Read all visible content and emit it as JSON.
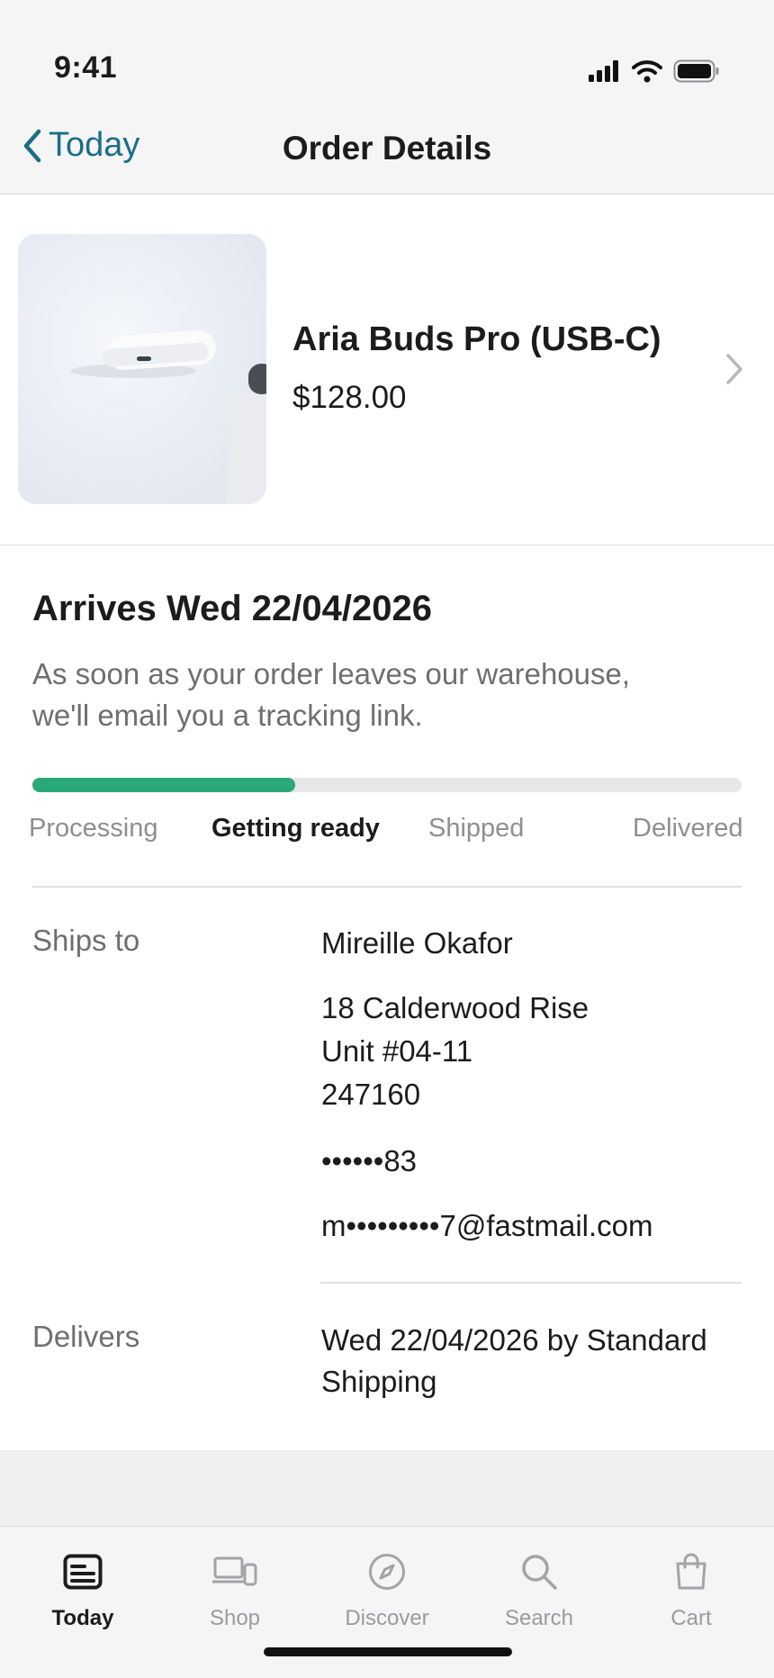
{
  "status": {
    "time": "9:41"
  },
  "nav": {
    "back_label": "Today",
    "title": "Order Details"
  },
  "product": {
    "name": "Aria Buds Pro (USB-C)",
    "price": "$128.00"
  },
  "delivery": {
    "arrives": "Arrives Wed 22/04/2026",
    "note": "As soon as your order leaves our warehouse, we'll email you a tracking link.",
    "progress": 0.37,
    "steps": [
      "Processing",
      "Getting ready",
      "Shipped",
      "Delivered"
    ],
    "active_step": "Getting ready",
    "accent_color": "#2aa877"
  },
  "ships_to": {
    "label": "Ships to",
    "name": "Mireille Okafor",
    "address_line1": "18 Calderwood Rise",
    "address_line2": "Unit #04-11",
    "postal": "247160",
    "phone": "••••••83",
    "email": "m•••••••••7@fastmail.com"
  },
  "delivers": {
    "label": "Delivers",
    "value": "Wed 22/04/2026 by Standard Shipping"
  },
  "tabs": [
    {
      "label": "Today",
      "icon": "today-icon",
      "active": true
    },
    {
      "label": "Shop",
      "icon": "devices-icon",
      "active": false
    },
    {
      "label": "Discover",
      "icon": "compass-icon",
      "active": false
    },
    {
      "label": "Search",
      "icon": "search-icon",
      "active": false
    },
    {
      "label": "Cart",
      "icon": "bag-icon",
      "active": false
    }
  ]
}
